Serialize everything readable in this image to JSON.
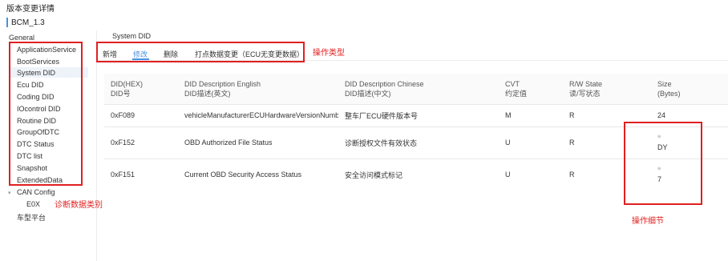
{
  "header": {
    "title": "版本变更详情",
    "version": "BCM_1.3"
  },
  "sidebar": {
    "items": [
      {
        "label": "General",
        "active": false
      },
      {
        "label": "ApplicationService",
        "active": false
      },
      {
        "label": "BootServices",
        "active": false
      },
      {
        "label": "System DID",
        "active": true
      },
      {
        "label": "Ecu DID",
        "active": false
      },
      {
        "label": "Coding DID",
        "active": false
      },
      {
        "label": "IOcontrol DID",
        "active": false
      },
      {
        "label": "Routine DID",
        "active": false
      },
      {
        "label": "GroupOfDTC",
        "active": false
      },
      {
        "label": "DTC Status",
        "active": false
      },
      {
        "label": "DTC list",
        "active": false
      },
      {
        "label": "Snapshot",
        "active": false
      },
      {
        "label": "ExtendedData",
        "active": false
      }
    ],
    "tree": {
      "can_config": "CAN Config",
      "eox": "E0X",
      "platform": "车型平台"
    }
  },
  "main": {
    "section_title": "System DID",
    "tabs": [
      "新增",
      "修改",
      "删除",
      "打点数据变更（ECU无变更数据）"
    ],
    "active_tab": "修改",
    "table": {
      "headers": [
        {
          "en": "DID(HEX)",
          "cn": "DID号"
        },
        {
          "en": "DID Description English",
          "cn": "DID描述(英文)"
        },
        {
          "en": "DID Description Chinese",
          "cn": "DID描述(中文)"
        },
        {
          "en": "CVT",
          "cn": "约定值"
        },
        {
          "en": "R/W State",
          "cn": "读/写状态"
        },
        {
          "en": "Size",
          "cn": "(Bytes)"
        }
      ],
      "rows": [
        {
          "did": "0xF089",
          "desc_en": "vehicleManufacturerECUHardwareVersionNumberD",
          "desc_cn": "整车厂ECU硬件版本号",
          "cvt": "M",
          "rw": "R",
          "size_top": "",
          "size": "24"
        },
        {
          "did": "0xF152",
          "desc_en": "OBD Authorized File Status",
          "desc_cn": "诊断授权文件有效状态",
          "cvt": "U",
          "rw": "R",
          "size_top": "≡",
          "size": "DY"
        },
        {
          "did": "0xF151",
          "desc_en": "Current OBD Security Access Status",
          "desc_cn": "安全访问模式标记",
          "cvt": "U",
          "rw": "R",
          "size_top": "≡",
          "size": "7"
        }
      ]
    }
  },
  "annotations": {
    "op_type": "操作类型",
    "diag_category": "诊断数据类别",
    "op_detail": "操作细节",
    "color": "#e02020"
  }
}
